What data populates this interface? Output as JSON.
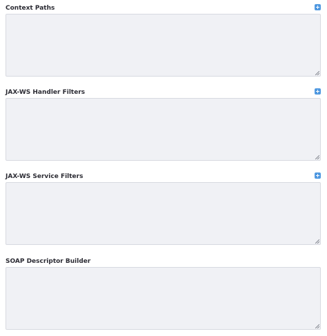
{
  "fields": [
    {
      "label": "Context Paths",
      "value": "",
      "has_add": true
    },
    {
      "label": "JAX-WS Handler Filters",
      "value": "",
      "has_add": true
    },
    {
      "label": "JAX-WS Service Filters",
      "value": "",
      "has_add": true
    },
    {
      "label": "SOAP Descriptor Builder",
      "value": "",
      "has_add": false
    }
  ],
  "icons": {
    "add": "plus-square-icon",
    "resize": "resize-grip-icon"
  },
  "colors": {
    "label_text": "#2b2b33",
    "add_button": "#4f98e0",
    "textarea_bg": "#f0f1f5",
    "textarea_border": "#d7d9e0"
  }
}
